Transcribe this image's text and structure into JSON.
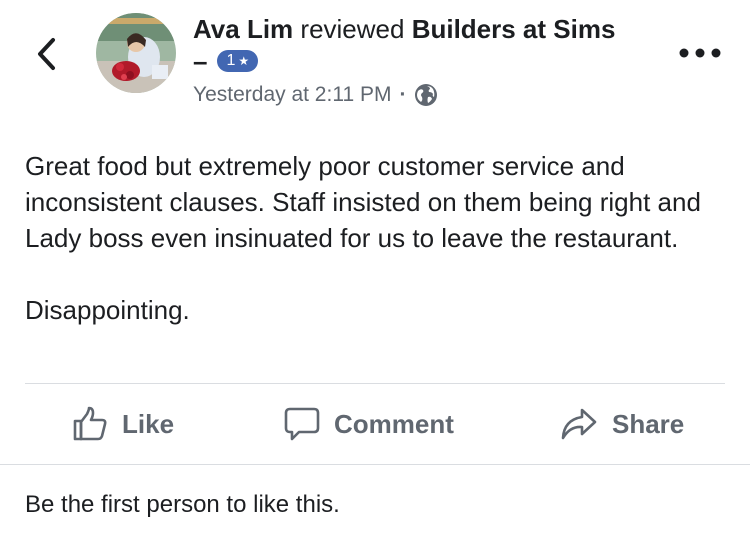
{
  "header": {
    "author_name": "Ava Lim",
    "verb": " reviewed ",
    "page_name": "Builders at Sims",
    "dash": "–",
    "rating_value": "1",
    "rating_star": "★",
    "timestamp": "Yesterday at 2:11 PM",
    "separator": "·",
    "privacy_icon": "globe-icon",
    "back_icon": "chevron-left-icon",
    "more_icon": "more-dots-icon"
  },
  "review": {
    "paragraphs": [
      "Great food but extremely poor customer service and inconsistent clauses. Staff insisted on them being right and Lady boss even insinuated for us to leave the restaurant.",
      "Disappointing."
    ]
  },
  "actions": {
    "like_label": "Like",
    "like_icon": "thumbs-up-icon",
    "comment_label": "Comment",
    "comment_icon": "comment-bubble-icon",
    "share_label": "Share",
    "share_icon": "share-arrow-icon"
  },
  "footer": {
    "reactions_text": "Be the first person to like this."
  },
  "colors": {
    "badge": "#4267b2",
    "secondary_text": "#606770",
    "primary_text": "#1c1e21",
    "divider": "#dadde1"
  }
}
